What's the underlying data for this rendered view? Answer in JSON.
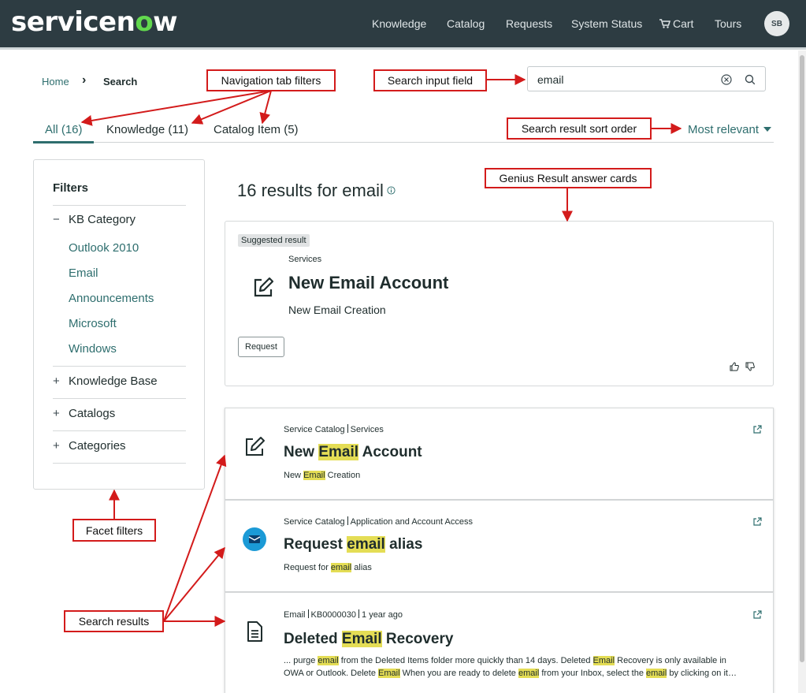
{
  "header": {
    "logo_text_a": "servicen",
    "logo_text_b": "o",
    "logo_text_c": "w",
    "nav": [
      "Knowledge",
      "Catalog",
      "Requests",
      "System Status",
      "Cart",
      "Tours"
    ],
    "avatar_initials": "SB"
  },
  "breadcrumb": {
    "home": "Home",
    "current": "Search"
  },
  "search": {
    "value": "email"
  },
  "tabs": [
    {
      "label": "All (16)",
      "active": true
    },
    {
      "label": "Knowledge (11)",
      "active": false
    },
    {
      "label": "Catalog Item (5)",
      "active": false
    }
  ],
  "sort": {
    "label": "Most relevant"
  },
  "facets": {
    "title": "Filters",
    "kb_category": {
      "label": "KB Category",
      "items": [
        "Outlook 2010",
        "Email",
        "Announcements",
        "Microsoft",
        "Windows"
      ]
    },
    "collapsed": [
      "Knowledge Base",
      "Catalogs",
      "Categories"
    ]
  },
  "results_header": {
    "text": "16 results for email"
  },
  "genius": {
    "badge": "Suggested result",
    "category": "Services",
    "title": "New Email Account",
    "subtitle": "New Email Creation",
    "button": "Request"
  },
  "results": [
    {
      "meta": [
        "Service Catalog",
        "Services"
      ],
      "title_parts": [
        "New ",
        "Email",
        " Account"
      ],
      "desc_parts": [
        "New ",
        "Email",
        " Creation"
      ]
    },
    {
      "meta": [
        "Service Catalog",
        "Application and Account Access"
      ],
      "title_parts": [
        "Request ",
        "email",
        " alias"
      ],
      "desc_parts": [
        "Request for ",
        "email",
        " alias"
      ]
    },
    {
      "meta": [
        "Email",
        "KB0000030",
        "1 year ago"
      ],
      "title_parts": [
        "Deleted ",
        "Email",
        " Recovery"
      ],
      "desc_line1": [
        "... purge ",
        "email",
        " from the Deleted Items folder more quickly than 14 days. Deleted ",
        "Email",
        " Recovery is only available in"
      ],
      "desc_line2": [
        "OWA or Outlook. Delete ",
        "Email",
        " When you are ready to delete ",
        "email",
        " from your Inbox, select the ",
        "email",
        " by clicking on it…"
      ]
    }
  ],
  "annotations": {
    "nav_tabs": "Navigation tab filters",
    "search_input": "Search input field",
    "sort_order": "Search result sort order",
    "genius_cards": "Genius Result answer cards",
    "facet_filters": "Facet filters",
    "search_results": "Search results"
  },
  "colors": {
    "header_bg": "#2d3c42",
    "accent_teal": "#2e6e6e",
    "highlight": "#e4dd55",
    "annotation_red": "#d31b1b"
  }
}
